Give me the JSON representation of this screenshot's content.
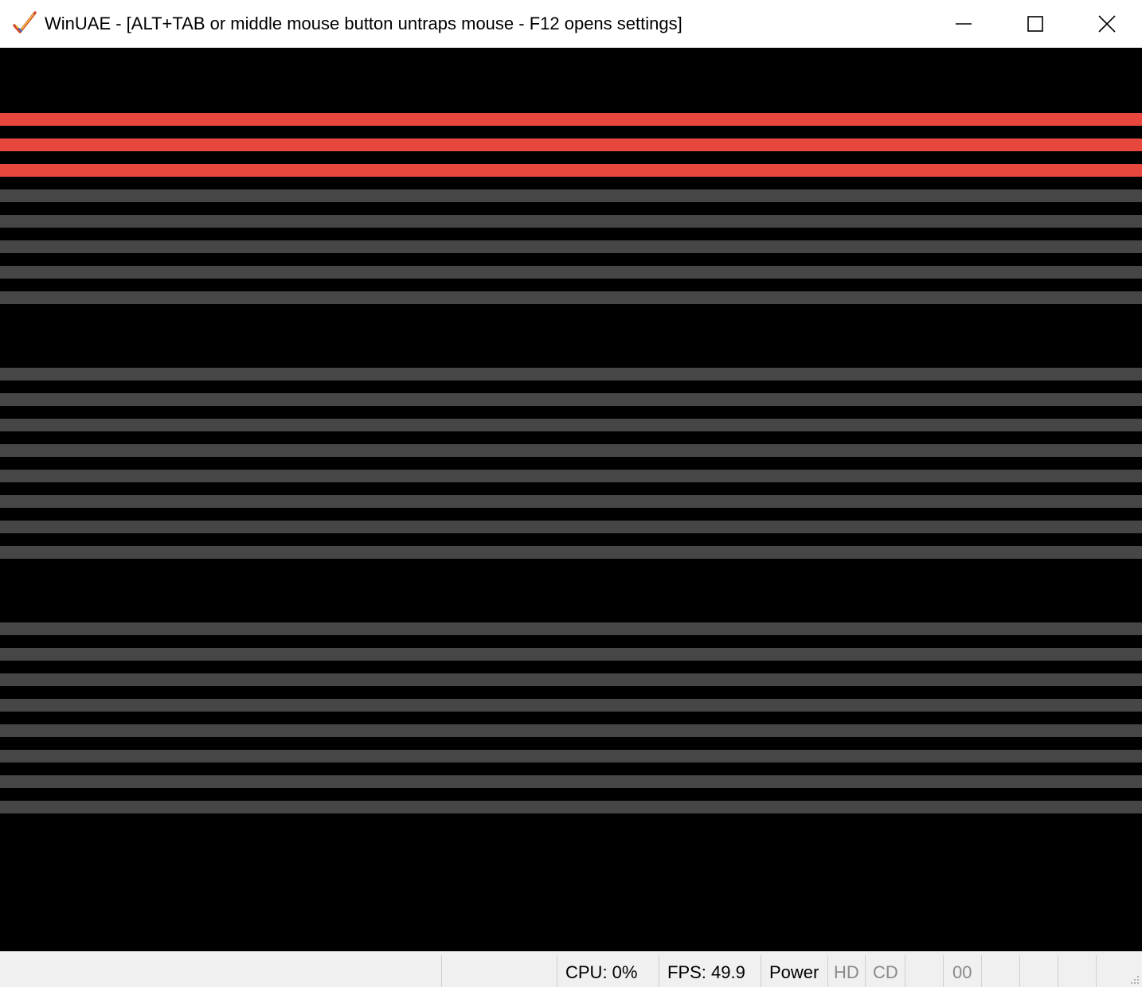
{
  "window": {
    "title": "WinUAE - [ALT+TAB or middle mouse button untraps mouse - F12 opens settings]",
    "app_icon": "winuae-checkmark-icon",
    "buttons": {
      "minimize": "minimize-icon",
      "maximize": "maximize-icon",
      "close": "close-icon"
    }
  },
  "display": {
    "background": "#000000",
    "stripe_colors": {
      "red": "#e8473e",
      "gray": "#464646"
    },
    "stripe_groups": [
      {
        "color": "red",
        "count": 3
      },
      {
        "color": "gray",
        "count": 5
      },
      {
        "color": "gray",
        "count": 8
      },
      {
        "color": "gray",
        "count": 8
      }
    ]
  },
  "statusbar": {
    "cpu": "CPU: 0%",
    "fps": "FPS: 49.9",
    "power": "Power",
    "hd": "HD",
    "cd": "CD",
    "drive_counter": "00"
  }
}
